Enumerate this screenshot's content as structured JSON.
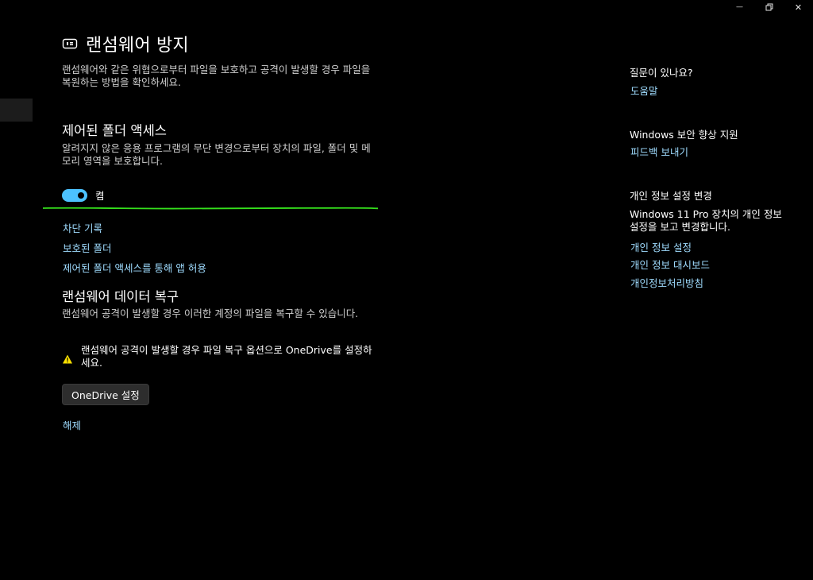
{
  "window": {
    "minimize_glyph": "—",
    "maximize_icon": "restore-icon",
    "close_glyph": "✕"
  },
  "header": {
    "title": "랜섬웨어 방지",
    "icon": "ransomware-shield-icon",
    "description": "랜섬웨어와 같은 위협으로부터 파일을 보호하고 공격이 발생할 경우 파일을 복원하는 방법을 확인하세요."
  },
  "controlled_folder_access": {
    "title": "제어된 폴더 액세스",
    "description": "알려지지 않은 응용 프로그램의 무단 변경으로부터 장치의 파일, 폴더 및 메모리 영역을 보호합니다.",
    "toggle_on": true,
    "toggle_label": "켬",
    "links": [
      "차단 기록",
      "보호된 폴더",
      "제어된 폴더 액세스를 통해 앱 허용"
    ]
  },
  "ransomware_recovery": {
    "title": "랜섬웨어 데이터 복구",
    "description": "랜섬웨어 공격이 발생할 경우 이러한 계정의 파일을 복구할 수 있습니다.",
    "warning_icon": "warning-icon",
    "warning_text": "랜섬웨어 공격이 발생할 경우 파일 복구 옵션으로 OneDrive를 설정하세요.",
    "button_label": "OneDrive 설정",
    "dismiss_label": "해제"
  },
  "sidebar": {
    "help_heading": "질문이 있나요?",
    "help_link": "도움말",
    "improve_heading": "Windows 보안 향상 지원",
    "feedback_link": "피드백 보내기",
    "privacy_heading": "개인 정보 설정 변경",
    "privacy_desc": "Windows 11 Pro 장치의 개인 정보 설정을 보고 변경합니다.",
    "privacy_links": [
      "개인 정보 설정",
      "개인 정보 대시보드",
      "개인정보처리방침"
    ]
  },
  "colors": {
    "accent": "#4cc2ff",
    "link": "#9fdcff",
    "marker": "#35e01c",
    "warning": "#fce100"
  }
}
